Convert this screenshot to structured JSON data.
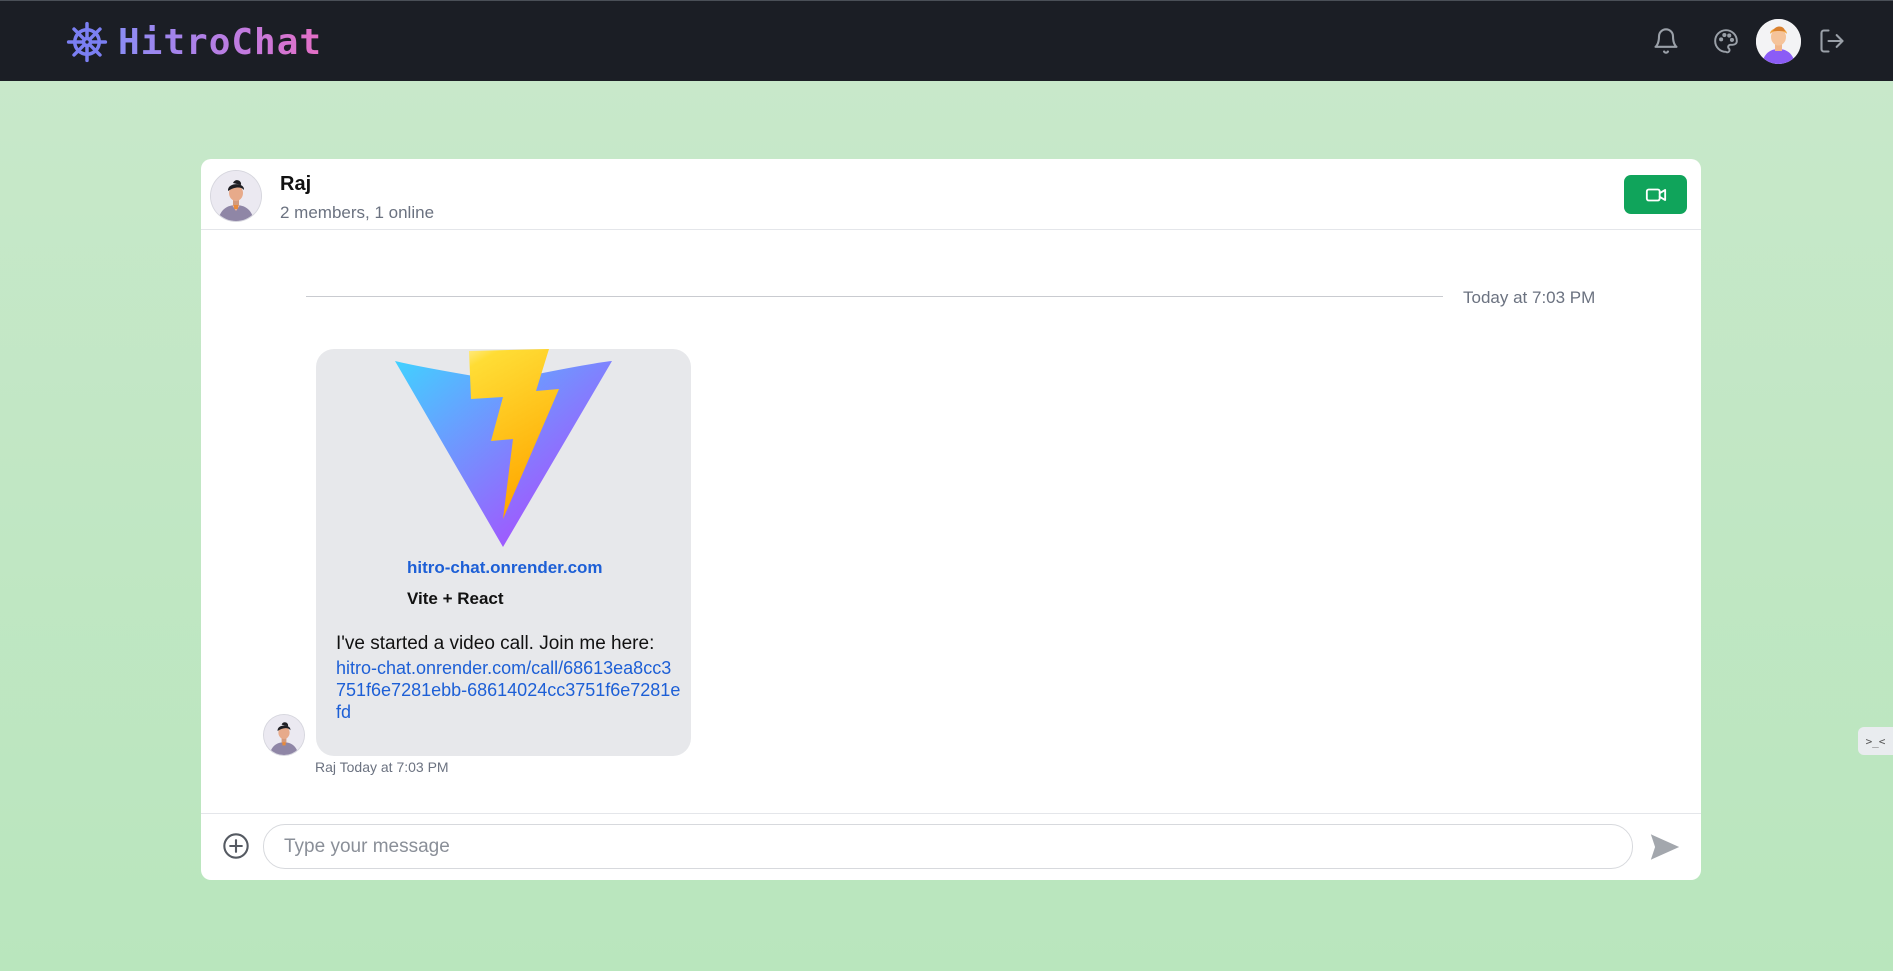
{
  "app": {
    "name": "HitroChat"
  },
  "navbar": {
    "icons": [
      "ship-wheel-icon",
      "bell-icon",
      "palette-icon",
      "user-avatar",
      "logout-icon"
    ]
  },
  "chat": {
    "name": "Raj",
    "status": "2 members, 1 online",
    "date_divider": "Today at 7:03 PM",
    "message": {
      "preview_domain": "hitro-chat.onrender.com",
      "preview_title": "Vite + React",
      "text": "I've started a video call. Join me here:",
      "link": "hitro-chat.onrender.com/call/68613ea8cc3751f6e7281ebb-68614024cc3751f6e7281efd",
      "meta": "Raj Today at 7:03 PM"
    }
  },
  "composer": {
    "placeholder": "Type your message"
  },
  "side_widget": {
    "label": ">_<"
  },
  "colors": {
    "video_button": "#10a45b",
    "link": "#1d5fd6",
    "navbar": "#1b1e25"
  }
}
